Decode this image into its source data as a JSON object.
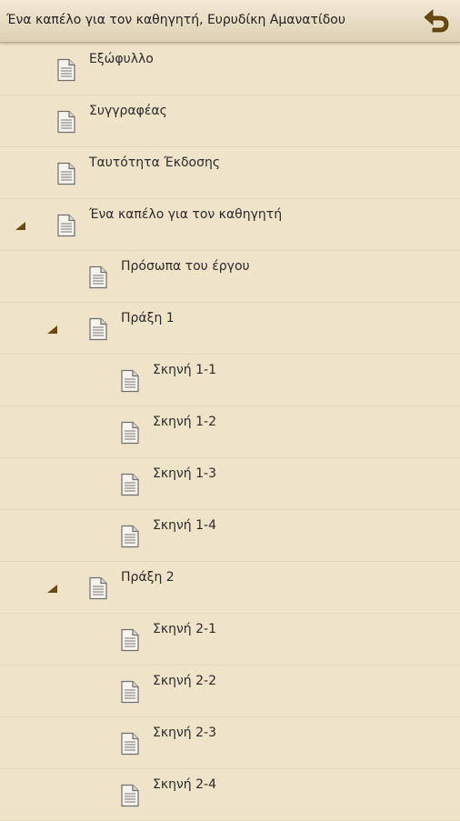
{
  "header": {
    "title": "Ένα καπέλο για τον καθηγητή, Ευρυδίκη Αμανατίδου",
    "back_icon": "back-arrow-icon",
    "accent_color": "#6a4a12"
  },
  "tree": [
    {
      "label": "Εξώφυλλο",
      "level": 0,
      "expanded": false
    },
    {
      "label": "Συγγραφέας",
      "level": 0,
      "expanded": false
    },
    {
      "label": "Ταυτότητα Έκδοσης",
      "level": 0,
      "expanded": false
    },
    {
      "label": "Ένα καπέλο για τον καθηγητή",
      "level": 0,
      "expanded": true
    },
    {
      "label": "Πρόσωπα του έργου",
      "level": 1,
      "expanded": false
    },
    {
      "label": "Πράξη 1",
      "level": 1,
      "expanded": true
    },
    {
      "label": "Σκηνή 1-1",
      "level": 2,
      "expanded": false
    },
    {
      "label": "Σκηνή 1-2",
      "level": 2,
      "expanded": false
    },
    {
      "label": "Σκηνή 1-3",
      "level": 2,
      "expanded": false
    },
    {
      "label": "Σκηνή 1-4",
      "level": 2,
      "expanded": false
    },
    {
      "label": "Πράξη 2",
      "level": 1,
      "expanded": true
    },
    {
      "label": "Σκηνή 2-1",
      "level": 2,
      "expanded": false
    },
    {
      "label": "Σκηνή 2-2",
      "level": 2,
      "expanded": false
    },
    {
      "label": "Σκηνή 2-3",
      "level": 2,
      "expanded": false
    },
    {
      "label": "Σκηνή 2-4",
      "level": 2,
      "expanded": false
    }
  ]
}
